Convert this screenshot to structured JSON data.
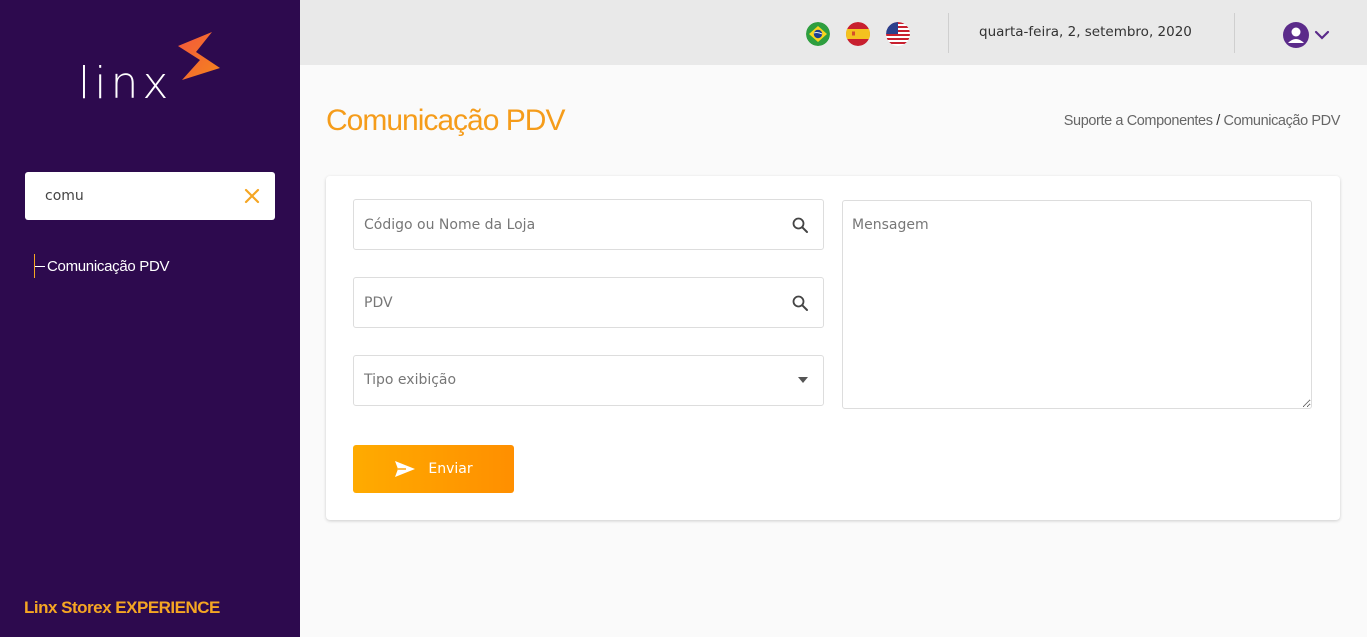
{
  "brand": {
    "logo_text": "linx",
    "footer": "Linx Storex EXPERIENCE",
    "accent": "#f5a623",
    "sidebar_bg": "#2d0a4e"
  },
  "sidebar": {
    "search_value": "comu",
    "items": [
      {
        "label": "Comunicação PDV"
      }
    ]
  },
  "header": {
    "languages": [
      "flag-brazil-icon",
      "flag-spain-icon",
      "flag-usa-icon"
    ],
    "date": "quarta-feira, 2, setembro, 2020",
    "user_icon": "user-circle-icon"
  },
  "page": {
    "title": "Comunicação PDV",
    "breadcrumb": {
      "parent": "Suporte a Componentes",
      "separator": "/",
      "current": "Comunicação PDV"
    }
  },
  "form": {
    "store_placeholder": "Código ou Nome da Loja",
    "pdv_placeholder": "PDV",
    "display_type_placeholder": "Tipo exibição",
    "message_placeholder": "Mensagem",
    "send_label": "Enviar"
  }
}
